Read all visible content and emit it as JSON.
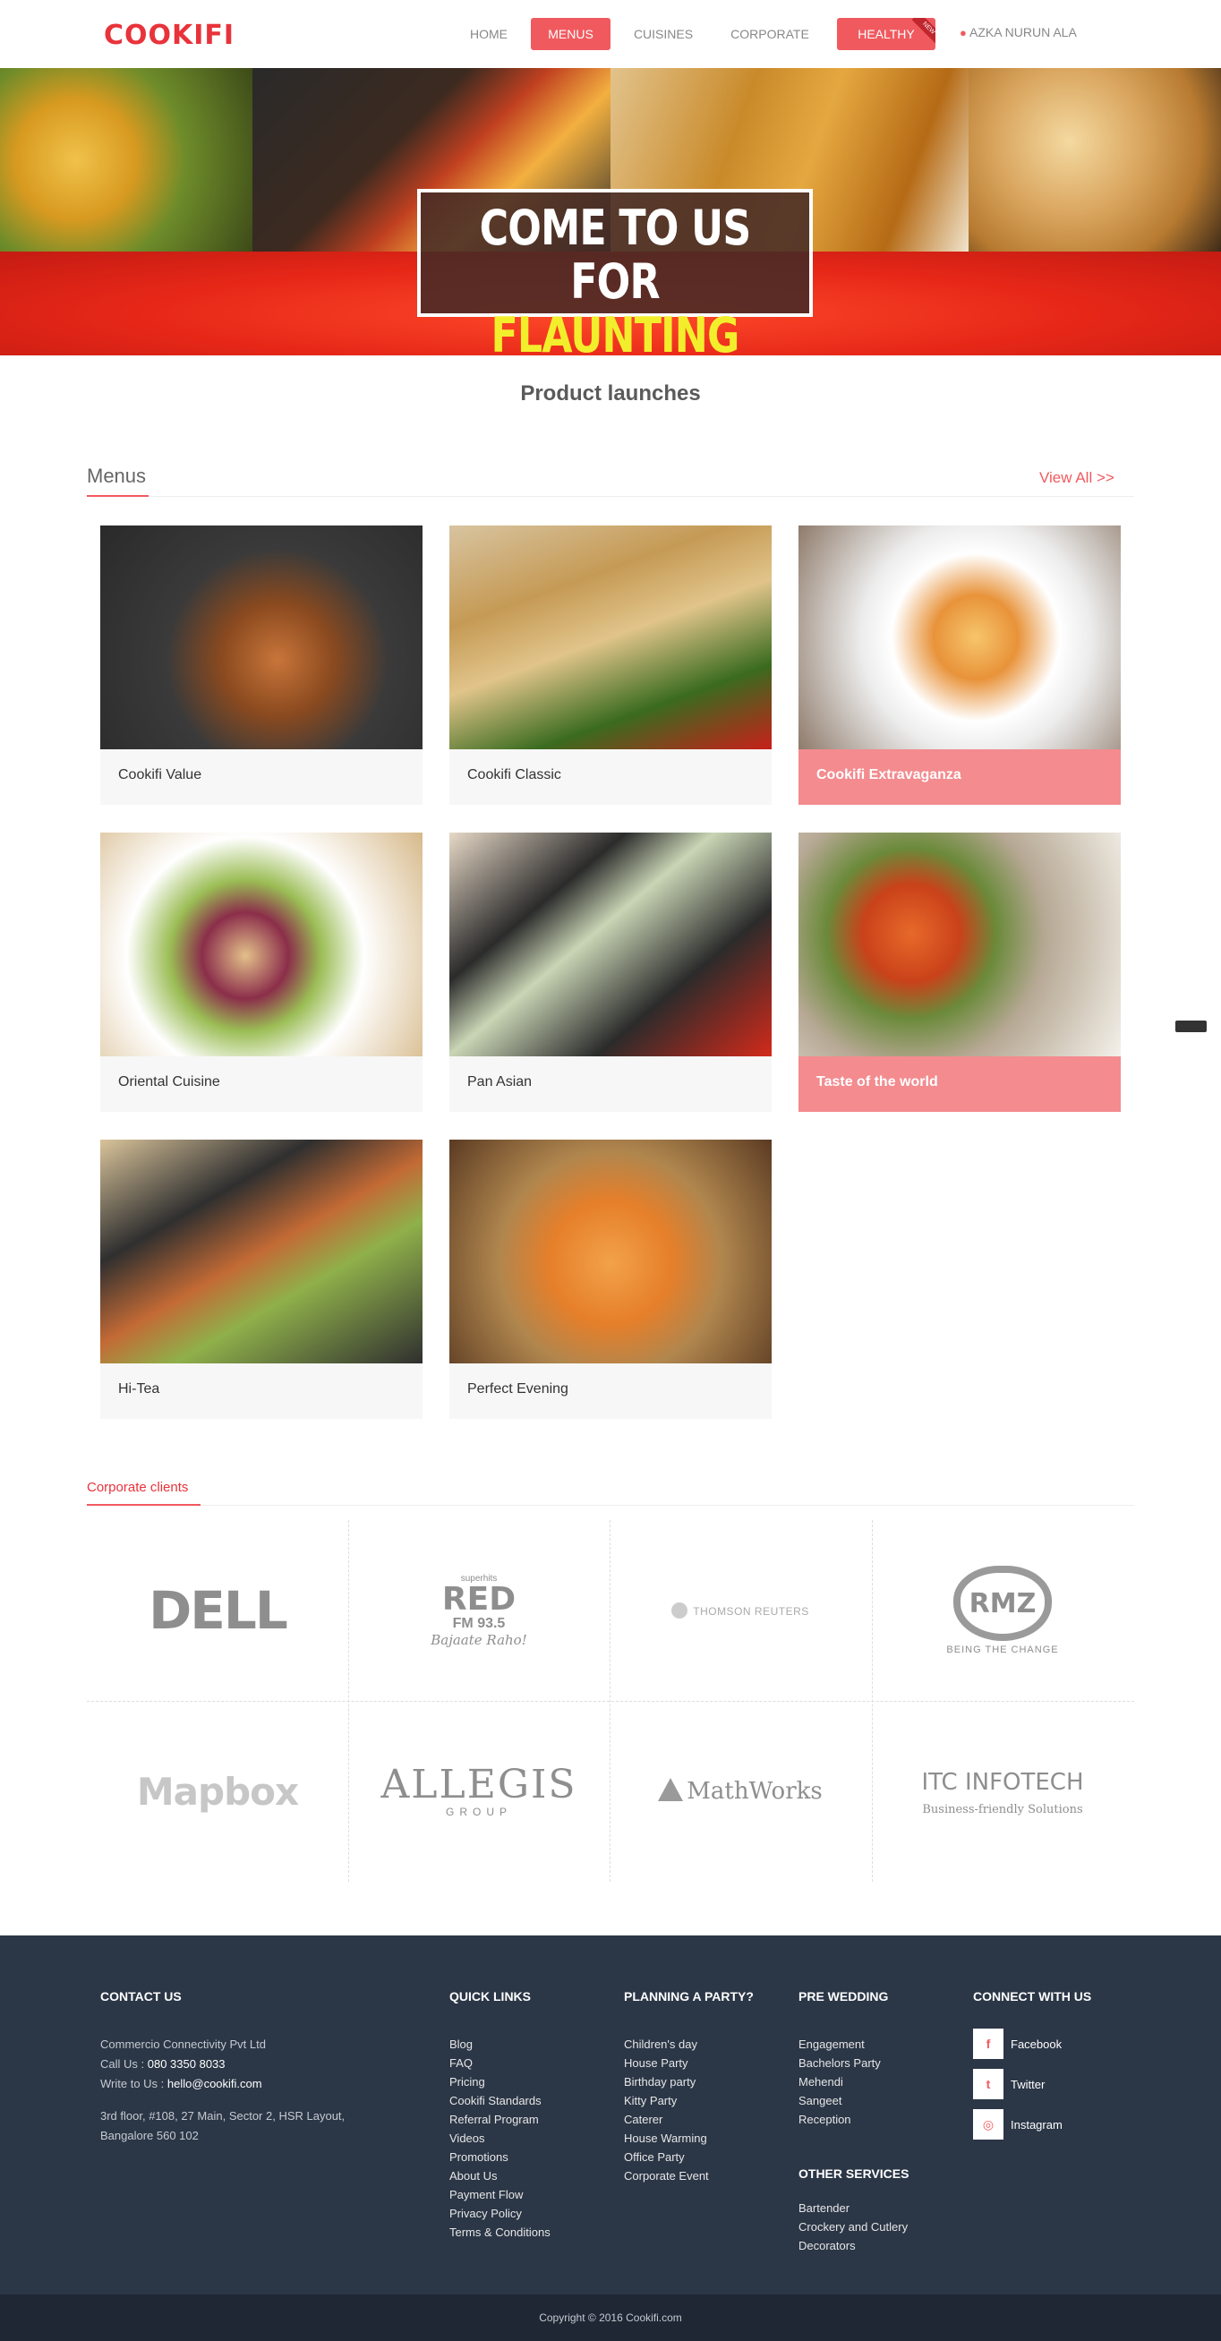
{
  "header": {
    "logo": "COOKIFI",
    "nav": [
      {
        "label": "HOME",
        "state": "default"
      },
      {
        "label": "MENUS",
        "state": "active"
      },
      {
        "label": "CUISINES",
        "state": "default"
      },
      {
        "label": "CORPORATE",
        "state": "default"
      },
      {
        "label": "HEALTHY",
        "state": "highlight",
        "ribbon": "NEW"
      }
    ],
    "user": "AZKA NURUN ALA",
    "user_icon": "user-icon"
  },
  "hero": {
    "line1": "COME TO US FOR",
    "line2": "FLAUNTING HI-TEAS"
  },
  "product_launches": "Product launches",
  "menus": {
    "title": "Menus",
    "view_all": "View All >>",
    "items": [
      {
        "label": "Cookifi Value",
        "highlight": false
      },
      {
        "label": "Cookifi Classic",
        "highlight": false
      },
      {
        "label": "Cookifi Extravaganza",
        "highlight": true
      },
      {
        "label": "Oriental Cuisine",
        "highlight": false
      },
      {
        "label": "Pan Asian",
        "highlight": false
      },
      {
        "label": "Taste of the world",
        "highlight": true
      },
      {
        "label": "Hi-Tea",
        "highlight": false
      },
      {
        "label": "Perfect Evening",
        "highlight": false
      }
    ]
  },
  "corporate": {
    "title": "Corporate clients",
    "logos": {
      "dell": "DELL",
      "red_top": "superhits",
      "red_main": "RED",
      "red_freq": "FM 93.5",
      "red_tag": "Bajaate Raho!",
      "thomson": "THOMSON REUTERS",
      "rmz_main": "RMZ",
      "rmz_tag": "BEING THE CHANGE",
      "mapbox": "Mapbox",
      "allegis_main": "ALLEGIS",
      "allegis_sub": "GROUP",
      "mathworks": "MathWorks",
      "itc_main": "ITC INFOTECH",
      "itc_tag": "Business-friendly Solutions"
    }
  },
  "footer": {
    "contact": {
      "head": "CONTACT US",
      "company": "Commercio Connectivity Pvt Ltd",
      "call_label": "Call Us :",
      "call_value": "080 3350 8033",
      "write_label": "Write to Us :",
      "write_value": "hello@cookifi.com",
      "address1": "3rd floor, #108, 27 Main, Sector 2, HSR Layout,",
      "address2": "Bangalore 560 102"
    },
    "quick_links": {
      "head": "QUICK LINKS",
      "items": [
        "Blog",
        "FAQ",
        "Pricing",
        "Cookifi Standards",
        "Referral Program",
        "Videos",
        "Promotions",
        "About Us",
        "Payment Flow",
        "Privacy Policy",
        "Terms & Conditions"
      ]
    },
    "party": {
      "head": "PLANNING A PARTY?",
      "items": [
        "Children's day",
        "House Party",
        "Birthday party",
        "Kitty Party",
        "Caterer",
        "House Warming",
        "Office Party",
        "Corporate Event"
      ]
    },
    "pre_wedding": {
      "head": "PRE WEDDING",
      "items": [
        "Engagement",
        "Bachelors Party",
        "Mehendi",
        "Sangeet",
        "Reception"
      ]
    },
    "other": {
      "head": "OTHER SERVICES",
      "items": [
        "Bartender",
        "Crockery and Cutlery",
        "Decorators"
      ]
    },
    "connect": {
      "head": "CONNECT WITH US",
      "items": [
        {
          "label": "Facebook",
          "icon": "facebook-icon",
          "glyph": "f"
        },
        {
          "label": "Twitter",
          "icon": "twitter-icon",
          "glyph": "t"
        },
        {
          "label": "Instagram",
          "icon": "instagram-icon",
          "glyph": "◎"
        }
      ]
    },
    "copyright": "Copyright © 2016 Cookifi.com"
  },
  "colors": {
    "accent": "#f05a5f",
    "footer_bg": "#2b3646",
    "copyright_bg": "#1e2733",
    "highlight_card": "#f38b8f"
  }
}
